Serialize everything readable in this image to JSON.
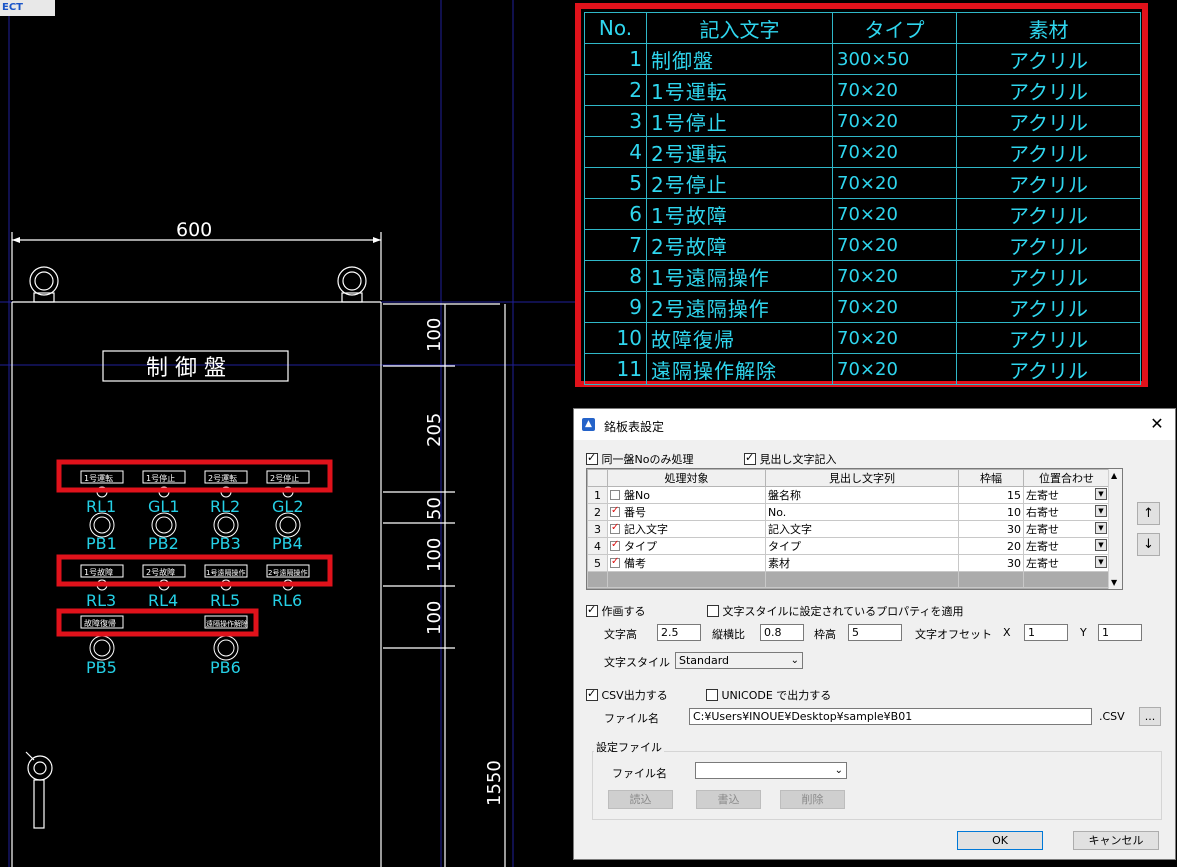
{
  "corner_chip": "ECT",
  "drawing": {
    "width_dim": "600",
    "panel_title": "制 御 盤",
    "dims": [
      "100",
      "205",
      "50",
      "100",
      "100",
      "1550"
    ],
    "row1_plates": [
      "1号運転",
      "1号停止",
      "2号運転",
      "2号停止"
    ],
    "row1_labels": [
      "RL1",
      "GL1",
      "RL2",
      "GL2"
    ],
    "row1_sublabels": [
      "PB1",
      "PB2",
      "PB3",
      "PB4"
    ],
    "row2_plates": [
      "1号故障",
      "2号故障",
      "1号遠隔操作",
      "2号遠隔操作"
    ],
    "row2_labels": [
      "RL3",
      "RL4",
      "RL5",
      "RL6"
    ],
    "row3_plates": [
      "故障復帰",
      "遠隔操作解除"
    ],
    "row3_labels": [
      "PB5",
      "PB6"
    ]
  },
  "nameplate_table": {
    "headers": [
      "No.",
      "記入文字",
      "タイプ",
      "素材"
    ],
    "rows": [
      {
        "no": "1",
        "text": "制御盤",
        "type": "300×50",
        "material": "アクリル"
      },
      {
        "no": "2",
        "text": "1号運転",
        "type": "70×20",
        "material": "アクリル"
      },
      {
        "no": "3",
        "text": "1号停止",
        "type": "70×20",
        "material": "アクリル"
      },
      {
        "no": "4",
        "text": "2号運転",
        "type": "70×20",
        "material": "アクリル"
      },
      {
        "no": "5",
        "text": "2号停止",
        "type": "70×20",
        "material": "アクリル"
      },
      {
        "no": "6",
        "text": "1号故障",
        "type": "70×20",
        "material": "アクリル"
      },
      {
        "no": "7",
        "text": "2号故障",
        "type": "70×20",
        "material": "アクリル"
      },
      {
        "no": "8",
        "text": "1号遠隔操作",
        "type": "70×20",
        "material": "アクリル"
      },
      {
        "no": "9",
        "text": "2号遠隔操作",
        "type": "70×20",
        "material": "アクリル"
      },
      {
        "no": "10",
        "text": "故障復帰",
        "type": "70×20",
        "material": "アクリル"
      },
      {
        "no": "11",
        "text": "遠隔操作解除",
        "type": "70×20",
        "material": "アクリル"
      }
    ]
  },
  "dialog": {
    "title": "銘板表設定",
    "chk_same_panel": "同一盤Noのみ処理",
    "chk_header_text": "見出し文字記入",
    "grid": {
      "headers": [
        "処理対象",
        "見出し文字列",
        "枠幅",
        "位置合わせ"
      ],
      "rows": [
        {
          "n": "1",
          "target": "盤No",
          "checked": false,
          "header": "盤名称",
          "width": "15",
          "align": "左寄せ"
        },
        {
          "n": "2",
          "target": "番号",
          "checked": true,
          "header": "No.",
          "width": "10",
          "align": "右寄せ"
        },
        {
          "n": "3",
          "target": "記入文字",
          "checked": true,
          "header": "記入文字",
          "width": "30",
          "align": "左寄せ"
        },
        {
          "n": "4",
          "target": "タイプ",
          "checked": true,
          "header": "タイプ",
          "width": "20",
          "align": "左寄せ"
        },
        {
          "n": "5",
          "target": "備考",
          "checked": true,
          "header": "素材",
          "width": "30",
          "align": "左寄せ"
        }
      ]
    },
    "up_label": "↑",
    "down_label": "↓",
    "chk_draw": "作画する",
    "chk_style_props": "文字スタイルに設定されているプロパティを適用",
    "text_height_label": "文字高",
    "text_height": "2.5",
    "aspect_label": "縦横比",
    "aspect": "0.8",
    "frame_height_label": "枠高",
    "frame_height": "5",
    "offset_label": "文字オフセット",
    "x_label": "X",
    "x_value": "1",
    "y_label": "Y",
    "y_value": "1",
    "text_style_label": "文字スタイル",
    "text_style": "Standard",
    "chk_csv": "CSV出力する",
    "chk_unicode": "UNICODE で出力する",
    "file_label": "ファイル名",
    "file_path": "C:¥Users¥INOUE¥Desktop¥sample¥B01",
    "csv_ext": ".CSV",
    "browse_label": "...",
    "settings_group": "設定ファイル",
    "settings_file_label": "ファイル名",
    "settings_file_value": "",
    "read_label": "読込",
    "write_label": "書込",
    "delete_label": "削除",
    "ok_label": "OK",
    "cancel_label": "キャンセル"
  }
}
